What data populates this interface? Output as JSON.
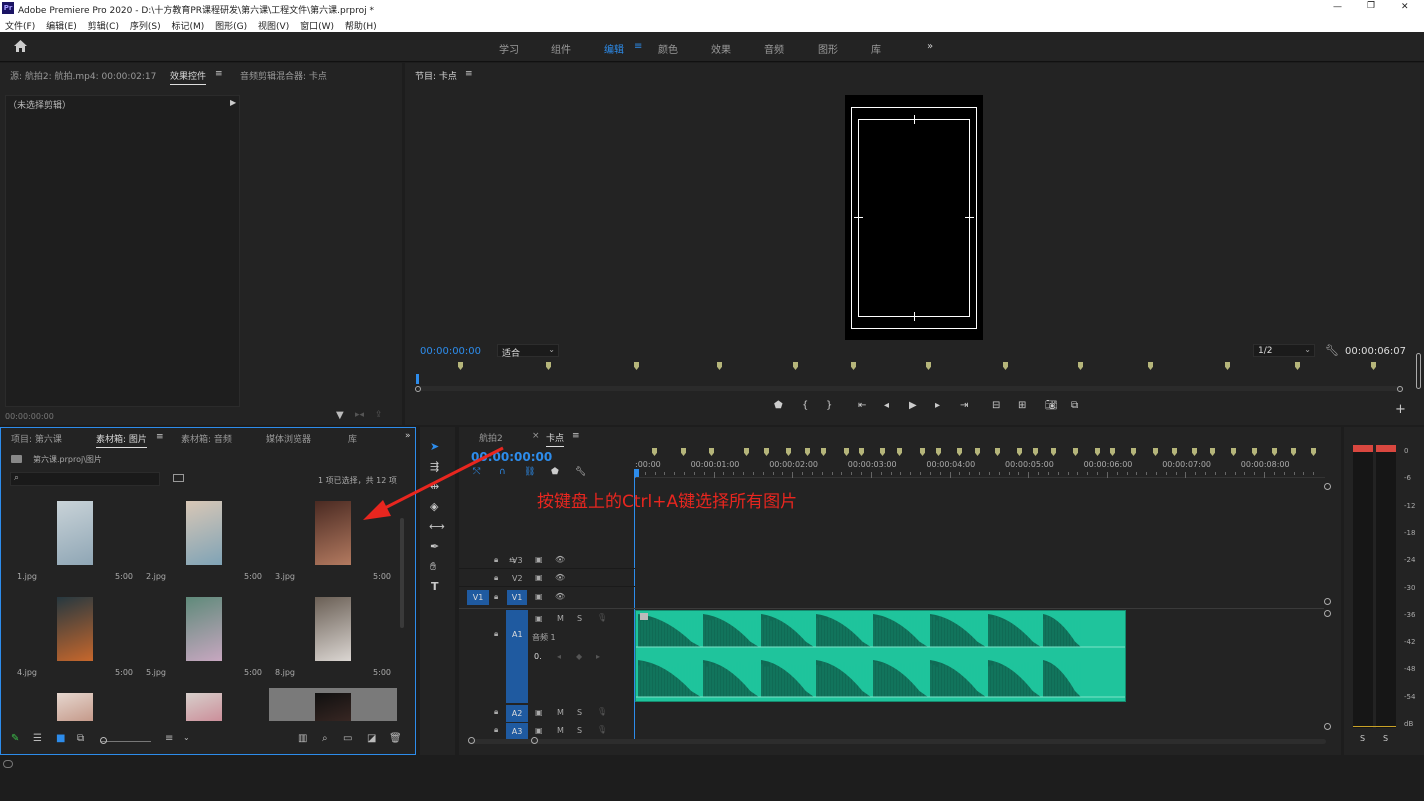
{
  "window": {
    "app_icon": "Pr",
    "title": "Adobe Premiere Pro 2020 - D:\\十方教育PR课程研发\\第六课\\工程文件\\第六课.prproj *",
    "controls": [
      "—",
      "❐",
      "✕"
    ]
  },
  "menu": [
    "文件(F)",
    "编辑(E)",
    "剪辑(C)",
    "序列(S)",
    "标记(M)",
    "图形(G)",
    "视图(V)",
    "窗口(W)",
    "帮助(H)"
  ],
  "workspaces": {
    "items": [
      "学习",
      "组件",
      "编辑",
      "颜色",
      "效果",
      "音频",
      "图形",
      "库"
    ],
    "active": "编辑",
    "more": "»"
  },
  "source_panel": {
    "tab_source": "源: 航拍2: 航拍.mp4: 00:00:02:17",
    "tab_effects": "效果控件",
    "tab_mixer": "音频剪辑混合器: 卡点",
    "no_clip": "（未选择剪辑）",
    "timecode": "00:00:00:00"
  },
  "program_monitor": {
    "title": "节目: 卡点",
    "timecode": "00:00:00:00",
    "fit": "适合",
    "resolution": "1/2",
    "duration": "00:00:06:07"
  },
  "project_panel": {
    "tabs": [
      "项目: 第六课",
      "素材箱: 图片",
      "素材箱: 音频",
      "媒体浏览器",
      "库"
    ],
    "active_tab": "素材箱: 图片",
    "path": "第六课.prproj\\图片",
    "selection_info": "1 项已选择，共 12 项",
    "items": [
      {
        "name": "1.jpg",
        "duration": "5:00",
        "colors": [
          "#c9d3d8",
          "#8fa6b5"
        ]
      },
      {
        "name": "2.jpg",
        "duration": "5:00",
        "colors": [
          "#d8c7b6",
          "#7fa3b6"
        ]
      },
      {
        "name": "3.jpg",
        "duration": "5:00",
        "colors": [
          "#4a2a22",
          "#b37a60"
        ]
      },
      {
        "name": "4.jpg",
        "duration": "5:00",
        "colors": [
          "#263840",
          "#c7672c"
        ]
      },
      {
        "name": "5.jpg",
        "duration": "5:00",
        "colors": [
          "#5f8a7a",
          "#c7a7c0"
        ]
      },
      {
        "name": "8.jpg",
        "duration": "5:00",
        "colors": [
          "#6a5f55",
          "#dbd6d2"
        ]
      },
      {
        "name": "",
        "duration": "",
        "colors": [
          "#e6d7cf",
          "#a8644e"
        ]
      },
      {
        "name": "",
        "duration": "",
        "colors": [
          "#d7cfcb",
          "#c2566f"
        ]
      },
      {
        "name": "",
        "duration": "",
        "colors": [
          "#101010",
          "#5a3a33"
        ]
      }
    ]
  },
  "timeline": {
    "tabs": [
      "航拍2",
      "卡点"
    ],
    "active_tab": "卡点",
    "timecode": "00:00:00:00",
    "ruler": [
      ":00:00",
      "00:00:01:00",
      "00:00:02:00",
      "00:00:03:00",
      "00:00:04:00",
      "00:00:05:00",
      "00:00:06:00",
      "00:00:07:00",
      "00:00:08:00"
    ],
    "video_tracks": [
      "V3",
      "V2",
      "V1"
    ],
    "source_patch": "V1",
    "audio_tracks": [
      "A1",
      "A2",
      "A3"
    ],
    "audio_track_name": "音频 1",
    "toggle_m": "M",
    "toggle_s": "S",
    "audio_volume": "0."
  },
  "annotation": {
    "text": "按键盘上的Ctrl+A键选择所有图片",
    "color": "#e8261f"
  },
  "meter": {
    "scale": [
      "0",
      "-6",
      "-12",
      "-18",
      "-24",
      "-30",
      "-36",
      "-42",
      "-48",
      "-54",
      "dB"
    ],
    "solo": [
      "S",
      "S"
    ]
  },
  "colors": {
    "accent": "#2d8ceb",
    "audio_clip": "#1fc49c",
    "marker": "#b5b57a"
  }
}
